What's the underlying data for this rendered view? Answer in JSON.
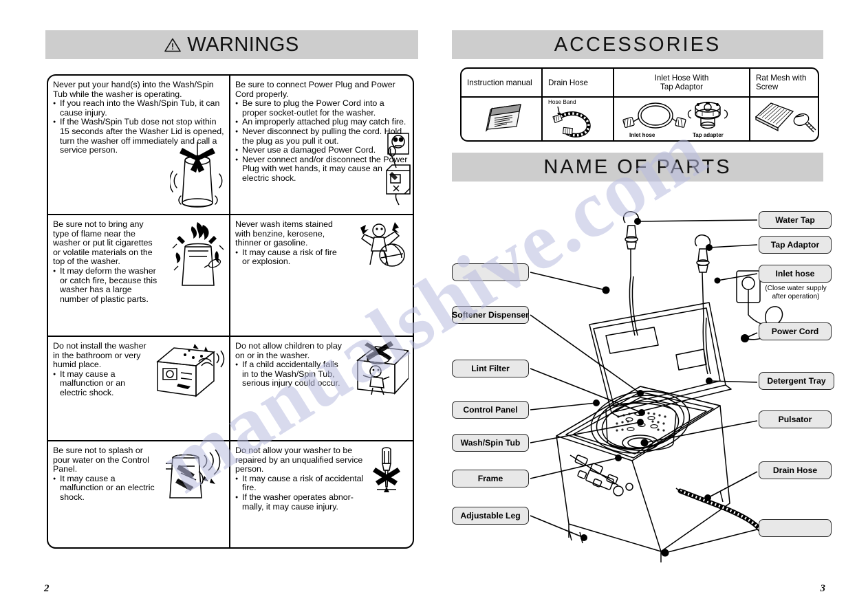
{
  "watermark": "manualshive.com",
  "left_page": {
    "number": "2",
    "header": {
      "icon": "warning-triangle-icon",
      "title": "WARNINGS"
    },
    "warnings": [
      {
        "id": "hand-into-tub",
        "heading": "Never put your hand(s) into the Wash/Spin Tub while the washer is operating.",
        "bullets": [
          "If you reach into the Wash/Spin Tub, it can cause injury.",
          "If the Wash/Spin Tub dose not stop within 15 seconds after the Washer Lid is opened, turn the washer off immediately and call a service person."
        ],
        "art": "spinning-tub-icon"
      },
      {
        "id": "power-plug-cord",
        "heading": "Be sure to connect Power Plug and Power Cord properly.",
        "bullets": [
          "Be sure to plug the Power Cord into a proper socket-outlet for the washer.",
          "An improperly attached plug may catch fire.",
          "Never disconnect by pulling the cord. Hold the plug as you pull it out.",
          "Never use a damaged Power Cord.",
          "Never connect and/or disconnect the Power Plug with wet hands, it may cause an electric shock."
        ],
        "art": "socket-outlet-and-wet-hand-icon"
      },
      {
        "id": "flame-near-washer",
        "heading": "Be sure not to bring any type of flame near the washer or put lit cigarettes or volatile materials on the top of the washer.",
        "bullets": [
          "It may deform the washer or catch fire, because this washer has a large number of plastic parts."
        ],
        "art": "burning-washer-icon"
      },
      {
        "id": "solvent-stained-items",
        "heading": "Never wash items stained with benzine, kerosene, thinner or gasoline.",
        "bullets": [
          "It may cause a risk of fire or explosion."
        ],
        "art": "explosion-figure-icon"
      },
      {
        "id": "bathroom-humid-install",
        "heading": "Do not install the washer in the bathroom or very humid place.",
        "bullets": [
          "It may cause a malfunction or an electric shock."
        ],
        "art": "humid-room-washer-icon"
      },
      {
        "id": "children-play",
        "heading": "Do not allow children to play on or in the washer.",
        "bullets": [
          "If a child accidentally falls in to the Wash/Spin Tub, serious injury could occur."
        ],
        "art": "child-falling-icon"
      },
      {
        "id": "water-on-control-panel",
        "heading": "Be sure not to splash or pour water on the Control Panel.",
        "bullets": [
          "It may cause a malfunction or an electric shock."
        ],
        "art": "splashing-water-icon"
      },
      {
        "id": "unqualified-repair",
        "heading": "Do not allow your washer to be repaired by an unqualified service person.",
        "bullets": [
          "It may cause a risk of accidental fire.",
          "If the washer operates abnor-mally, it may cause injury."
        ],
        "art": "no-screwdriver-icon"
      }
    ]
  },
  "right_page": {
    "number": "3",
    "accessories": {
      "header": {
        "title": "ACCESSORIES"
      },
      "columns": [
        {
          "label": "Instruction manual",
          "align": "left",
          "art": "instruction-manual-icon",
          "captions": []
        },
        {
          "label": "Drain Hose",
          "align": "left",
          "art": "drain-hose-icon",
          "captions": [
            "Hose Band"
          ]
        },
        {
          "label": "Inlet Hose With\nTap Adaptor",
          "align": "center",
          "art": "inlet-hose-tap-adaptor-icon",
          "captions": [
            "Inlet  hose",
            "Tap adapter"
          ]
        },
        {
          "label": "Rat Mesh with\nScrew",
          "align": "left",
          "art": "rat-mesh-screw-icon",
          "captions": []
        }
      ],
      "column_labels": {
        "c0": "Instruction manual",
        "c1": "Drain Hose",
        "c2_line1": "Inlet Hose With",
        "c2_line2": "Tap Adaptor",
        "c3_line1": "Rat Mesh with",
        "c3_line2": "Screw"
      },
      "captions": {
        "hose_band": "Hose Band",
        "inlet_hose": "Inlet  hose",
        "tap_adapter": "Tap adapter"
      }
    },
    "name_of_parts": {
      "header": {
        "title": "NAME  OF  PARTS"
      },
      "callouts_left": [
        {
          "id": "blank-top-left",
          "label": ""
        },
        {
          "id": "softener-dispenser",
          "label": "Softener Dispenser"
        },
        {
          "id": "lint-filter",
          "label": "Lint Filter"
        },
        {
          "id": "control-panel",
          "label": "Control Panel"
        },
        {
          "id": "wash-spin-tub",
          "label": "Wash/Spin Tub"
        },
        {
          "id": "frame",
          "label": "Frame"
        },
        {
          "id": "adjustable-leg",
          "label": "Adjustable Leg"
        }
      ],
      "callouts_right": [
        {
          "id": "water-tap",
          "label": "Water Tap"
        },
        {
          "id": "tap-adaptor",
          "label": "Tap Adaptor"
        },
        {
          "id": "inlet-hose",
          "label": "Inlet hose",
          "note_line1": "(Close water supply",
          "note_line2": "after operation)"
        },
        {
          "id": "power-cord",
          "label": "Power Cord"
        },
        {
          "id": "detergent-tray",
          "label": "Detergent Tray"
        },
        {
          "id": "pulsator",
          "label": "Pulsator"
        },
        {
          "id": "drain-hose",
          "label": "Drain Hose"
        },
        {
          "id": "blank-bottom-right",
          "label": ""
        }
      ]
    }
  },
  "colors": {
    "header_bar": "#cdcdcd",
    "callout_fill": "#e8e8e8",
    "line": "#000000",
    "watermark": "#b9bce0"
  }
}
